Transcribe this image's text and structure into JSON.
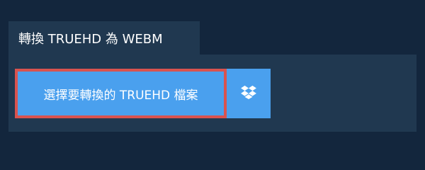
{
  "tab": {
    "label": "轉換 TRUEHD 為 WEBM"
  },
  "upload": {
    "label": "選擇要轉換的 TRUEHD 檔案"
  },
  "dropbox": {
    "icon": "dropbox-icon"
  },
  "colors": {
    "background": "#13263d",
    "panel": "#203850",
    "button": "#4aa0ee",
    "button_border": "#d9534f"
  }
}
